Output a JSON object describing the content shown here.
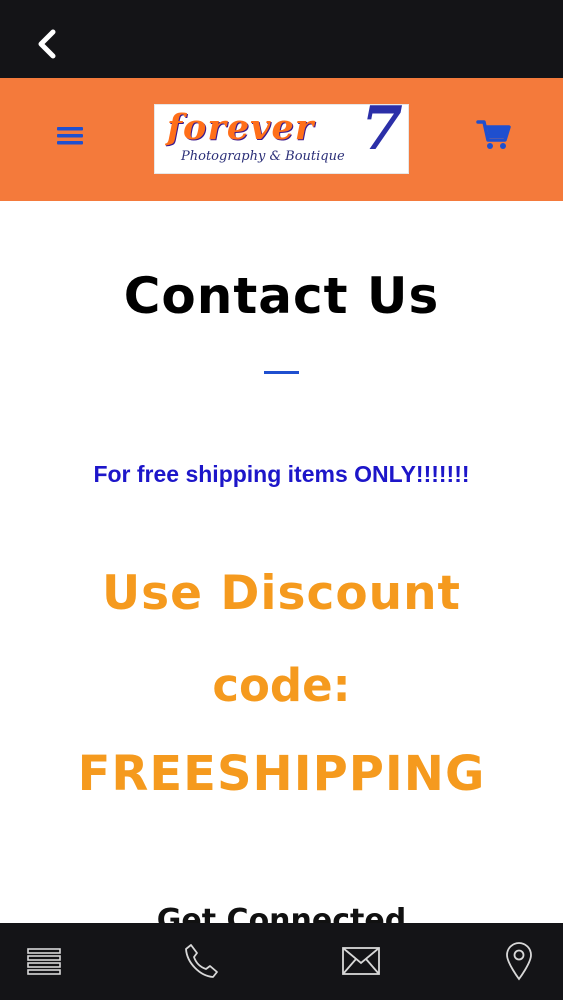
{
  "colors": {
    "top_bar": "#141417",
    "header": "#f47a3b",
    "icon_blue": "#1f4fcf",
    "note_blue": "#1d16c9",
    "promo_orange": "#f59a1e",
    "bottom_bar": "#141417"
  },
  "topbar": {
    "back_icon": "chevron-left-icon"
  },
  "header": {
    "menu_icon": "hamburger-icon",
    "cart_icon": "shopping-cart-icon",
    "logo": {
      "word": "forever",
      "numeral": "7",
      "tagline": "Photography & Boutique"
    }
  },
  "content": {
    "title": "Contact Us",
    "note": "For free shipping items ONLY!!!!!!!",
    "promo_line1": "Use Discount",
    "promo_line2": "code:",
    "promo_line3": "FREESHIPPING",
    "section_heading": "Get Connected"
  },
  "bottom_nav": [
    {
      "icon": "list-icon"
    },
    {
      "icon": "phone-icon"
    },
    {
      "icon": "mail-icon"
    },
    {
      "icon": "location-pin-icon"
    }
  ]
}
